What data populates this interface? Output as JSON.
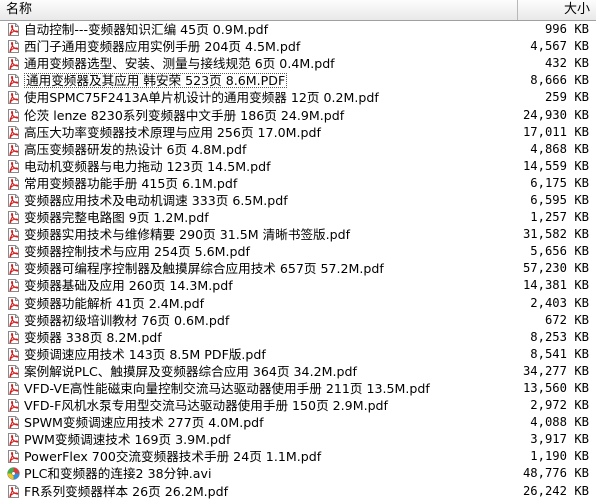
{
  "columns": {
    "name": "名称",
    "size": "大小"
  },
  "files": [
    {
      "name": "自动控制---变频器知识汇编 45页 0.9M.pdf",
      "size": "996 KB",
      "icon": "pdf-icon"
    },
    {
      "name": "西门子通用变频器应用实例手册 204页 4.5M.pdf",
      "size": "4,567 KB",
      "icon": "pdf-icon"
    },
    {
      "name": "通用变频器选型、安装、测量与接线规范 6页 0.4M.pdf",
      "size": "432 KB",
      "icon": "pdf-icon"
    },
    {
      "name": "通用变频器及其应用 韩安荣 523页 8.6M.PDF",
      "size": "8,666 KB",
      "icon": "pdf-icon",
      "selected": true
    },
    {
      "name": "使用SPMC75F2413A单片机设计的通用变频器 12页 0.2M.pdf",
      "size": "259 KB",
      "icon": "pdf-icon"
    },
    {
      "name": "伦茨 lenze 8230系列变频器中文手册 186页 24.9M.pdf",
      "size": "24,930 KB",
      "icon": "pdf-icon"
    },
    {
      "name": "高压大功率变频器技术原理与应用 256页 17.0M.pdf",
      "size": "17,011 KB",
      "icon": "pdf-icon"
    },
    {
      "name": "高压变频器研发的热设计 6页 4.8M.pdf",
      "size": "4,868 KB",
      "icon": "pdf-icon"
    },
    {
      "name": "电动机变频器与电力拖动 123页 14.5M.pdf",
      "size": "14,559 KB",
      "icon": "pdf-icon"
    },
    {
      "name": "常用变频器功能手册 415页 6.1M.pdf",
      "size": "6,175 KB",
      "icon": "pdf-icon"
    },
    {
      "name": "变频器应用技术及电动机调速 333页 6.5M.pdf",
      "size": "6,595 KB",
      "icon": "pdf-icon"
    },
    {
      "name": "变频器完整电路图 9页 1.2M.pdf",
      "size": "1,257 KB",
      "icon": "pdf-icon"
    },
    {
      "name": "变频器实用技术与维修精要 290页 31.5M 清晰书签版.pdf",
      "size": "31,582 KB",
      "icon": "pdf-icon"
    },
    {
      "name": "变频器控制技术与应用 254页 5.6M.pdf",
      "size": "5,656 KB",
      "icon": "pdf-icon"
    },
    {
      "name": "变频器可编程序控制器及触摸屏综合应用技术 657页 57.2M.pdf",
      "size": "57,230 KB",
      "icon": "pdf-icon"
    },
    {
      "name": "变频器基础及应用 260页 14.3M.pdf",
      "size": "14,381 KB",
      "icon": "pdf-icon"
    },
    {
      "name": "变频器功能解析 41页 2.4M.pdf",
      "size": "2,403 KB",
      "icon": "pdf-icon"
    },
    {
      "name": "变频器初级培训教材 76页 0.6M.pdf",
      "size": "672 KB",
      "icon": "pdf-icon"
    },
    {
      "name": "变频器 338页 8.2M.pdf",
      "size": "8,253 KB",
      "icon": "pdf-icon"
    },
    {
      "name": "变频调速应用技术 143页 8.5M PDF版.pdf",
      "size": "8,541 KB",
      "icon": "pdf-icon"
    },
    {
      "name": "案例解说PLC、触摸屏及变频器综合应用 364页 34.2M.pdf",
      "size": "34,277 KB",
      "icon": "pdf-icon"
    },
    {
      "name": "VFD-VE高性能磁束向量控制交流马达驱动器使用手册 211页 13.5M.pdf",
      "size": "13,560 KB",
      "icon": "pdf-icon"
    },
    {
      "name": "VFD-F风机水泵专用型交流马达驱动器使用手册 150页 2.9M.pdf",
      "size": "2,972 KB",
      "icon": "pdf-icon"
    },
    {
      "name": "SPWM变频调速应用技术 277页 4.0M.pdf",
      "size": "4,088 KB",
      "icon": "pdf-icon"
    },
    {
      "name": "PWM变频调速技术 169页 3.9M.pdf",
      "size": "3,917 KB",
      "icon": "pdf-icon"
    },
    {
      "name": "PowerFlex 700交流变频器技术手册 24页 1.1M.pdf",
      "size": "1,190 KB",
      "icon": "pdf-icon"
    },
    {
      "name": "PLC和变频器的连接2 38分钟.avi",
      "size": "48,776 KB",
      "icon": "avi-icon"
    },
    {
      "name": "FR系列变频器样本 26页 26.2M.pdf",
      "size": "26,242 KB",
      "icon": "pdf-icon"
    }
  ],
  "colors": {
    "pdf_red": "#d21f1f",
    "header_border": "#a0a0a0"
  }
}
